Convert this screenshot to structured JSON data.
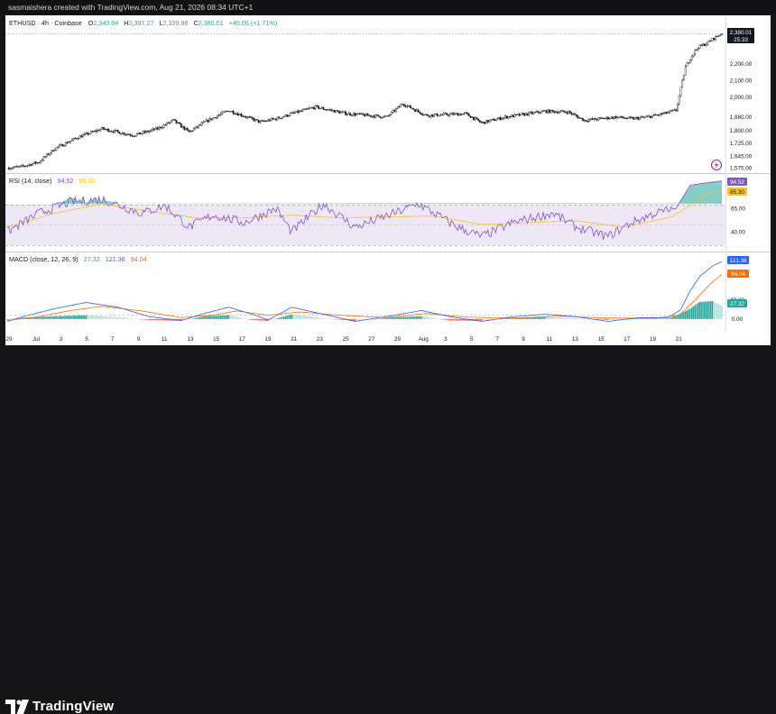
{
  "credit": "sasmaishera created with TradingView.com, Aug 21, 2026 08:34 UTC+1",
  "brand": "TradingView",
  "colors": {
    "up": "#26a69a",
    "down": "#ef5350",
    "price": "#131722",
    "rsi": "#7e57c2",
    "rsi_ma": "#fbc02d",
    "rsi_band": "#ede7f6",
    "macd": "#2962ff",
    "signal": "#ff6d00",
    "hist_up_strong": "#26a69a",
    "hist_up_weak": "#b2dfdb",
    "hist_down_strong": "#ef5350",
    "hist_down_weak": "#ffcdd2",
    "grid": "#f0f3fa",
    "axis_text": "#131722"
  },
  "main": {
    "symbol": "ETHUSD",
    "interval": "4h",
    "exchange": "Coinbase",
    "open_label": "O",
    "open": "2,340.04",
    "high_label": "H",
    "high": "2,397.27",
    "low_label": "L",
    "low": "2,339.98",
    "close_label": "C",
    "close": "2,380.01",
    "change": "+40.06 (+1.71%)",
    "last_price": "2,380.01",
    "countdown": "25:33"
  },
  "rsi": {
    "label": "RSI (14, close)",
    "value": "94.52",
    "ma_value": "85.30"
  },
  "macd": {
    "label": "MACD (close, 12, 26, 9)",
    "hist": "27.32",
    "macd": "121.36",
    "signal": "94.04"
  },
  "chart_data": [
    {
      "type": "candlestick",
      "title": "ETHUSD · 4h · Coinbase",
      "y_axis_side": "right",
      "yticks": [
        1575,
        1645,
        1725,
        1800,
        1880,
        2000,
        2100,
        2200
      ],
      "ytick_labels": [
        "1,575.00",
        "1,645.00",
        "1,725.00",
        "1,800.00",
        "1,880.00",
        "2,000.00",
        "2,100.00",
        "2,200.00"
      ],
      "ylim": [
        1560,
        2420
      ],
      "x_tick_labels": [
        "29",
        "Jul",
        "3",
        "5",
        "7",
        "9",
        "11",
        "13",
        "15",
        "17",
        "19",
        "21",
        "23",
        "25",
        "27",
        "29",
        "Aug",
        "3",
        "5",
        "7",
        "9",
        "11",
        "13",
        "15",
        "17",
        "19",
        "21"
      ],
      "grid": false,
      "close_path": {
        "index": [
          0,
          8,
          20,
          30,
          45,
          60,
          80,
          95,
          105,
          115,
          125,
          140,
          160,
          170,
          180,
          195,
          215,
          240,
          250,
          265,
          290,
          300,
          315,
          330,
          340,
          355,
          365,
          385,
          395,
          405,
          415,
          423,
          429,
          433,
          437,
          442,
          448,
          452
        ],
        "close": [
          1575,
          1580,
          1610,
          1690,
          1760,
          1810,
          1770,
          1810,
          1860,
          1790,
          1850,
          1920,
          1850,
          1870,
          1900,
          1940,
          1900,
          1880,
          1960,
          1890,
          1900,
          1845,
          1880,
          1900,
          1915,
          1910,
          1860,
          1880,
          1870,
          1880,
          1900,
          1920,
          2180,
          2250,
          2300,
          2320,
          2360,
          2380
        ]
      }
    },
    {
      "type": "line",
      "title": "RSI (14, close)",
      "yticks": [
        40,
        65,
        85.3,
        94.52
      ],
      "ytick_labels": [
        "40.00",
        "65.00",
        "85.30",
        "94.52"
      ],
      "ylim": [
        20,
        100
      ],
      "bands": [
        30,
        70
      ],
      "series": [
        {
          "name": "RSI",
          "index": [
            0,
            20,
            40,
            60,
            85,
            100,
            115,
            130,
            150,
            170,
            180,
            200,
            220,
            245,
            260,
            285,
            300,
            320,
            345,
            360,
            380,
            395,
            410,
            423,
            432,
            440,
            452
          ],
          "values": [
            40,
            60,
            72,
            75,
            60,
            68,
            45,
            58,
            50,
            65,
            40,
            70,
            45,
            60,
            70,
            45,
            35,
            50,
            60,
            45,
            35,
            50,
            60,
            65,
            90,
            92,
            94.52
          ]
        },
        {
          "name": "RSI-based MA",
          "index": [
            0,
            30,
            60,
            90,
            120,
            150,
            180,
            210,
            240,
            270,
            300,
            330,
            360,
            390,
            420,
            430,
            440,
            452
          ],
          "values": [
            45,
            60,
            70,
            62,
            55,
            55,
            58,
            55,
            56,
            57,
            48,
            50,
            52,
            45,
            56,
            66,
            78,
            85.3
          ]
        }
      ]
    },
    {
      "type": "line",
      "title": "MACD (close, 12, 26, 9)",
      "yticks": [
        0,
        40,
        94.04,
        121.36
      ],
      "ytick_labels": [
        "0.00",
        "40.00",
        "94.04",
        "121.36"
      ],
      "ylim": [
        -25,
        135
      ],
      "series": [
        {
          "name": "MACD",
          "index": [
            0,
            10,
            30,
            50,
            70,
            90,
            110,
            125,
            140,
            155,
            165,
            180,
            200,
            220,
            245,
            262,
            280,
            300,
            320,
            340,
            360,
            380,
            400,
            418,
            426,
            432,
            438,
            446,
            452
          ],
          "values": [
            -5,
            5,
            22,
            35,
            25,
            5,
            -3,
            12,
            25,
            10,
            -2,
            25,
            10,
            -5,
            8,
            18,
            5,
            -5,
            5,
            10,
            5,
            -5,
            3,
            3,
            20,
            60,
            90,
            112,
            121.36
          ]
        },
        {
          "name": "Signal",
          "index": [
            0,
            20,
            40,
            60,
            85,
            110,
            130,
            145,
            165,
            185,
            210,
            240,
            265,
            290,
            320,
            350,
            380,
            410,
            425,
            435,
            445,
            452
          ],
          "values": [
            -3,
            5,
            18,
            27,
            17,
            3,
            8,
            17,
            8,
            15,
            8,
            3,
            12,
            4,
            2,
            6,
            2,
            2,
            8,
            40,
            75,
            94.04
          ]
        },
        {
          "name": "Histogram",
          "index": [
            0,
            10,
            30,
            50,
            70,
            90,
            110,
            125,
            140,
            155,
            165,
            180,
            200,
            220,
            245,
            262,
            280,
            300,
            320,
            340,
            360,
            380,
            400,
            418,
            426,
            432,
            438,
            446,
            452
          ],
          "values": [
            -2,
            3,
            6,
            8,
            4,
            -2,
            -4,
            6,
            8,
            -2,
            -4,
            10,
            2,
            -4,
            4,
            6,
            -3,
            -4,
            3,
            4,
            2,
            -2,
            1,
            1,
            12,
            22,
            36,
            38,
            27.32
          ]
        }
      ]
    }
  ]
}
